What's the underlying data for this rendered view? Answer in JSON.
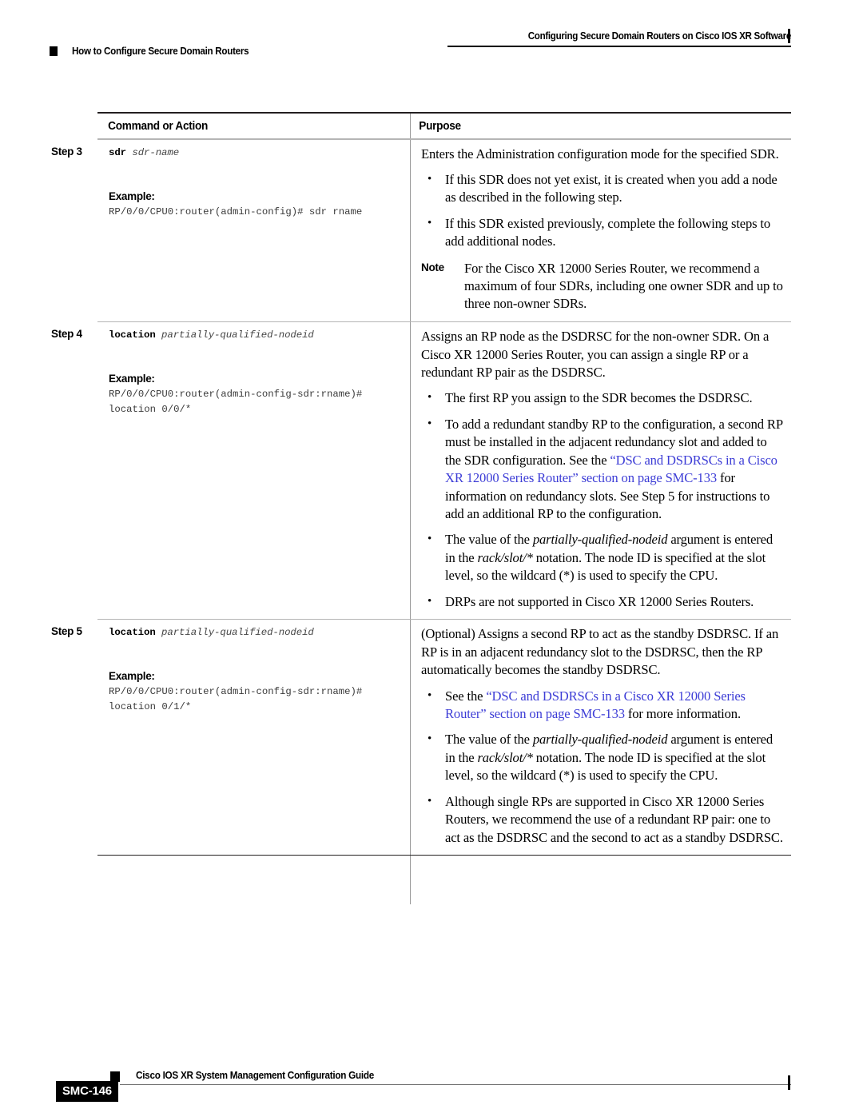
{
  "header": {
    "right_title": "Configuring Secure Domain Routers on Cisco IOS XR Software",
    "left_title": "How to Configure Secure Domain Routers"
  },
  "table": {
    "columns": {
      "command": "Command or Action",
      "purpose": "Purpose"
    },
    "rows": [
      {
        "step_label": "Step 3",
        "command_syntax_bold": "sdr",
        "command_syntax_italic": "sdr-name",
        "example_label": "Example:",
        "example_lines": [
          "RP/0/0/CPU0:router(admin-config)# sdr rname"
        ],
        "purpose_intro": "Enters the Administration configuration mode for the specified SDR.",
        "bullets": [
          "If this SDR does not yet exist, it is created when you add a node as described in the following step.",
          "If this SDR existed previously, complete the following steps to add additional nodes."
        ],
        "note": {
          "label": "Note",
          "text": "For the Cisco XR 12000 Series Router, we recommend a maximum of four SDRs, including one owner SDR and up to three non-owner SDRs."
        }
      },
      {
        "step_label": "Step 4",
        "command_syntax_bold": "location",
        "command_syntax_italic": "partially-qualified-nodeid",
        "example_label": "Example:",
        "example_lines": [
          "RP/0/0/CPU0:router(admin-config-sdr:rname)#",
          "location 0/0/*"
        ],
        "purpose_intro": "Assigns an RP node as the DSDRSC for the non-owner SDR. On a Cisco XR 12000 Series Router, you can assign a single RP or a redundant RP pair as the DSDRSC.",
        "bullet_1": "The first RP you assign to the SDR becomes the DSDRSC.",
        "bullet_2_pre": "To add a redundant standby RP to the configuration, a second RP must be installed in the adjacent redundancy slot and added to the SDR configuration. See the ",
        "bullet_2_link": "“DSC and DSDRSCs in a Cisco XR 12000 Series Router” section on page SMC-133",
        "bullet_2_post": " for information on redundancy slots. See Step 5 for instructions to add an additional RP to the configuration.",
        "bullet_3_pre": "The value of the ",
        "bullet_3_arg": "partially-qualified-nodeid",
        "bullet_3_mid": " argument is entered in the ",
        "bullet_3_notation": "rack/slot/*",
        "bullet_3_post": " notation. The node ID is specified at the slot level, so the wildcard (*) is used to specify the CPU.",
        "bullet_4": "DRPs are not supported in Cisco XR 12000 Series Routers."
      },
      {
        "step_label": "Step 5",
        "command_syntax_bold": "location",
        "command_syntax_italic": "partially-qualified-nodeid",
        "example_label": "Example:",
        "example_lines": [
          "RP/0/0/CPU0:router(admin-config-sdr:rname)#",
          "location 0/1/*"
        ],
        "purpose_intro": "(Optional) Assigns a second RP to act as the standby DSDRSC. If an RP is in an adjacent redundancy slot to the DSDRSC, then the RP automatically becomes the standby DSDRSC.",
        "bullet_1_pre": "See the ",
        "bullet_1_link": "“DSC and DSDRSCs in a Cisco XR 12000 Series Router” section on page SMC-133",
        "bullet_1_post": " for more information.",
        "bullet_2_pre": "The value of the ",
        "bullet_2_arg": "partially-qualified-nodeid",
        "bullet_2_mid": " argument is entered in the ",
        "bullet_2_notation": "rack/slot/*",
        "bullet_2_post": " notation. The node ID is specified at the slot level, so the wildcard (*) is used to specify the CPU.",
        "bullet_3": "Although single RPs are supported in Cisco XR 12000 Series Routers, we recommend the use of a redundant RP pair: one to act as the DSDRSC and the second to act as a standby DSDRSC."
      }
    ]
  },
  "footer": {
    "guide_title": "Cisco IOS XR System Management Configuration Guide",
    "page_number": "SMC-146"
  },
  "colors": {
    "link": "#3d3dd6",
    "rule_dark": "#231f20",
    "rule_light": "#b5b5b5"
  }
}
